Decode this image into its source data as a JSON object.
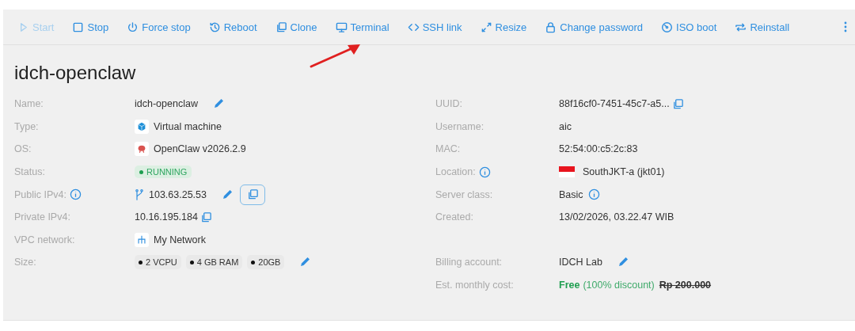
{
  "toolbar": [
    {
      "label": "Start",
      "disabled": true
    },
    {
      "label": "Stop",
      "disabled": false
    },
    {
      "label": "Force stop",
      "disabled": false
    },
    {
      "label": "Reboot",
      "disabled": false
    },
    {
      "label": "Clone",
      "disabled": false
    },
    {
      "label": "Terminal",
      "disabled": false
    },
    {
      "label": "SSH link",
      "disabled": false
    },
    {
      "label": "Resize",
      "disabled": false
    },
    {
      "label": "Change password",
      "disabled": false
    },
    {
      "label": "ISO boot",
      "disabled": false
    },
    {
      "label": "Reinstall",
      "disabled": false
    }
  ],
  "title": "idch-openclaw",
  "rows": [
    {
      "left": {
        "label": "Name:",
        "info": false,
        "kind": "editable",
        "value": "idch-openclaw"
      },
      "right": {
        "label": "UUID:",
        "info": false,
        "kind": "copyable",
        "value": "88f16cf0-7451-45c7-a5..."
      }
    },
    {
      "left": {
        "label": "Type:",
        "info": false,
        "kind": "vm",
        "value": "Virtual machine"
      },
      "right": {
        "label": "Username:",
        "info": false,
        "kind": "text",
        "value": "aic"
      }
    },
    {
      "left": {
        "label": "OS:",
        "info": false,
        "kind": "os",
        "value": "OpenClaw v2026.2.9"
      },
      "right": {
        "label": "MAC:",
        "info": false,
        "kind": "text",
        "value": "52:54:00:c5:2c:83"
      }
    },
    {
      "left": {
        "label": "Status:",
        "info": false,
        "kind": "status",
        "value": "RUNNING"
      },
      "right": {
        "label": "Location:",
        "info": true,
        "kind": "location",
        "value": "SouthJKT-a (jkt01)"
      }
    },
    {
      "left": {
        "label": "Public IPv4:",
        "info": true,
        "kind": "public_ip",
        "value": "103.63.25.53"
      },
      "right": {
        "label": "Server class:",
        "info": false,
        "kind": "info_value",
        "value": "Basic"
      }
    },
    {
      "left": {
        "label": "Private IPv4:",
        "info": false,
        "kind": "copyable",
        "value": "10.16.195.184"
      },
      "right": {
        "label": "Created:",
        "info": false,
        "kind": "text",
        "value": "13/02/2026, 03.22.47 WIB"
      }
    },
    {
      "left": {
        "label": "VPC network:",
        "info": false,
        "kind": "network",
        "value": "My Network"
      }
    },
    {
      "left": {
        "label": "Size:",
        "info": false,
        "kind": "chips",
        "chips": [
          "2 VCPU",
          "4 GB RAM",
          "20GB"
        ]
      },
      "right": {
        "label": "Billing account:",
        "info": false,
        "kind": "editable",
        "value": "IDCH Lab"
      }
    },
    {
      "right": {
        "label": "Est. monthly cost:",
        "info": false,
        "kind": "cost",
        "price": "Free",
        "discount": "(100% discount)",
        "original": "Rp 200.000"
      }
    }
  ]
}
